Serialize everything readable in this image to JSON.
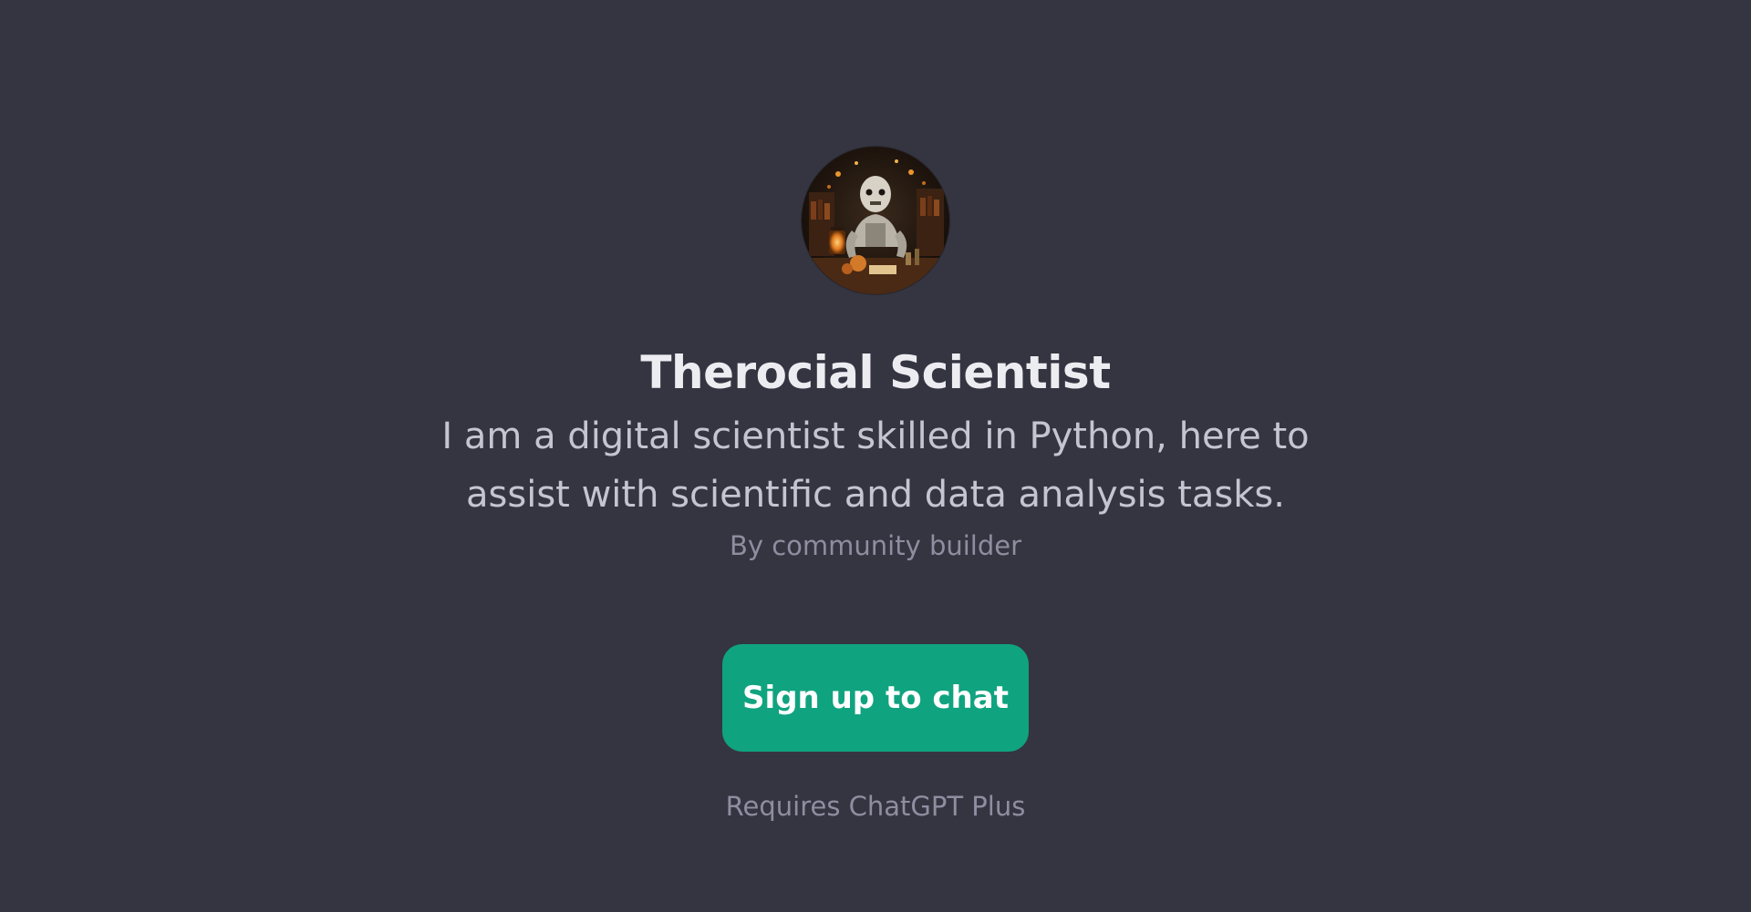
{
  "gpt": {
    "name": "Therocial Scientist",
    "description": "I am a digital scientist skilled in Python, here to assist with scientific and data analysis tasks.",
    "author": "By community builder",
    "avatar_icon": "robot-scientist-avatar"
  },
  "actions": {
    "signup_label": "Sign up to chat",
    "requirement_text": "Requires ChatGPT Plus"
  },
  "colors": {
    "background": "#343541",
    "accent": "#10a37f",
    "title": "#ececf1",
    "muted": "#8e8ea0"
  }
}
